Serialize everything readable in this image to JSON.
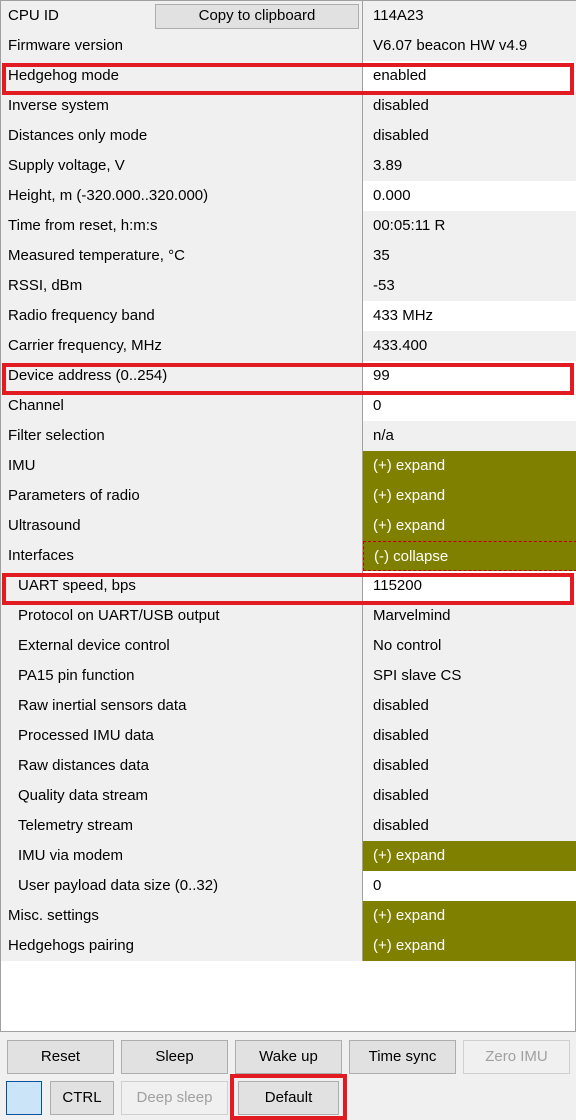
{
  "header": {
    "cpu_id_label": "CPU ID",
    "copy_button": "Copy to clipboard",
    "cpu_id_value": "114A23"
  },
  "rows": [
    {
      "label": "Firmware version",
      "value": "V6.07 beacon HW v4.9"
    },
    {
      "label": "Hedgehog mode",
      "value": "enabled"
    },
    {
      "label": "Inverse system",
      "value": "disabled"
    },
    {
      "label": "Distances only mode",
      "value": "disabled"
    },
    {
      "label": "Supply voltage, V",
      "value": "3.89"
    },
    {
      "label": "Height, m (-320.000..320.000)",
      "value": "0.000"
    },
    {
      "label": "Time from reset, h:m:s",
      "value": "00:05:11   R"
    },
    {
      "label": "Measured temperature, °C",
      "value": "35"
    },
    {
      "label": "RSSI, dBm",
      "value": "-53"
    },
    {
      "label": "Radio frequency band",
      "value": "433 MHz"
    },
    {
      "label": "Carrier frequency, MHz",
      "value": "433.400"
    },
    {
      "label": "Device address (0..254)",
      "value": "99"
    },
    {
      "label": "Channel",
      "value": "0"
    },
    {
      "label": "Filter selection",
      "value": "n/a"
    },
    {
      "label": "IMU",
      "value": "(+) expand"
    },
    {
      "label": "Parameters of radio",
      "value": "(+) expand"
    },
    {
      "label": "Ultrasound",
      "value": "(+) expand"
    },
    {
      "label": "Interfaces",
      "value": "(-) collapse"
    },
    {
      "label": "UART speed, bps",
      "value": "115200"
    },
    {
      "label": "Protocol on UART/USB output",
      "value": "Marvelmind"
    },
    {
      "label": "External device control",
      "value": "No control"
    },
    {
      "label": "PA15 pin function",
      "value": "SPI slave CS"
    },
    {
      "label": "Raw inertial sensors data",
      "value": "disabled"
    },
    {
      "label": "Processed IMU data",
      "value": "disabled"
    },
    {
      "label": "Raw distances data",
      "value": "disabled"
    },
    {
      "label": "Quality data stream",
      "value": "disabled"
    },
    {
      "label": "Telemetry stream",
      "value": "disabled"
    },
    {
      "label": "IMU via modem",
      "value": "(+) expand"
    },
    {
      "label": "User payload data size (0..32)",
      "value": "0"
    },
    {
      "label": "Misc. settings",
      "value": "(+) expand"
    },
    {
      "label": "Hedgehogs pairing",
      "value": "(+) expand"
    }
  ],
  "buttons": {
    "reset": "Reset",
    "sleep": "Sleep",
    "wake_up": "Wake up",
    "time_sync": "Time sync",
    "zero_imu": "Zero IMU",
    "ctrl": "CTRL",
    "deep_sleep": "Deep sleep",
    "default": "Default"
  },
  "colors": {
    "expand_bg": "#808000",
    "highlight": "#e21b23"
  }
}
